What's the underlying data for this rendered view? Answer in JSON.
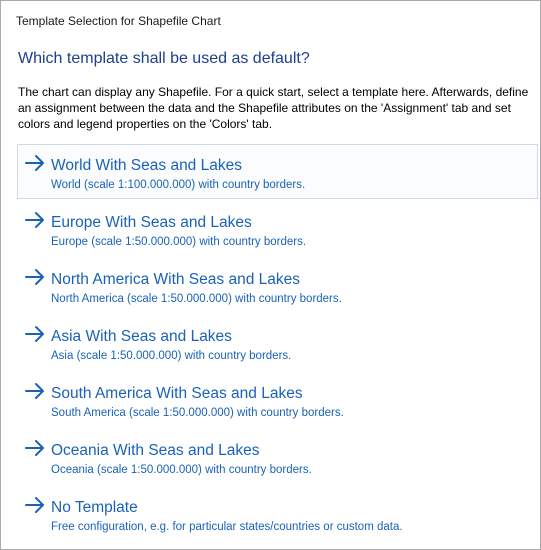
{
  "window": {
    "title": "Template Selection for Shapefile Chart"
  },
  "heading": "Which template shall be used as default?",
  "description": "The chart can display any Shapefile. For a quick start, select a template here. Afterwards, define an assignment between the data and the Shapefile attributes on the 'Assignment' tab and set colors and legend properties on the 'Colors' tab.",
  "options": [
    {
      "title": "World With Seas and Lakes",
      "subtitle": "World (scale 1:100.000.000) with country borders.",
      "icon": "arrow-right-icon"
    },
    {
      "title": "Europe With Seas and Lakes",
      "subtitle": "Europe (scale 1:50.000.000) with country borders.",
      "icon": "arrow-right-icon"
    },
    {
      "title": "North America With Seas and Lakes",
      "subtitle": "North America (scale 1:50.000.000) with country borders.",
      "icon": "arrow-right-icon"
    },
    {
      "title": "Asia With Seas and Lakes",
      "subtitle": "Asia (scale 1:50.000.000) with country borders.",
      "icon": "arrow-right-icon"
    },
    {
      "title": "South America With Seas and Lakes",
      "subtitle": "South America (scale 1:50.000.000) with country borders.",
      "icon": "arrow-right-icon"
    },
    {
      "title": "Oceania With Seas and Lakes",
      "subtitle": "Oceania (scale 1:50.000.000) with country borders.",
      "icon": "arrow-right-icon"
    },
    {
      "title": "No Template",
      "subtitle": "Free configuration, e.g. for particular states/countries or custom data.",
      "icon": "arrow-right-icon"
    }
  ],
  "colors": {
    "heading": "#1e3f8c",
    "link": "#1a62b8",
    "selected_border": "#cfd9e8"
  }
}
